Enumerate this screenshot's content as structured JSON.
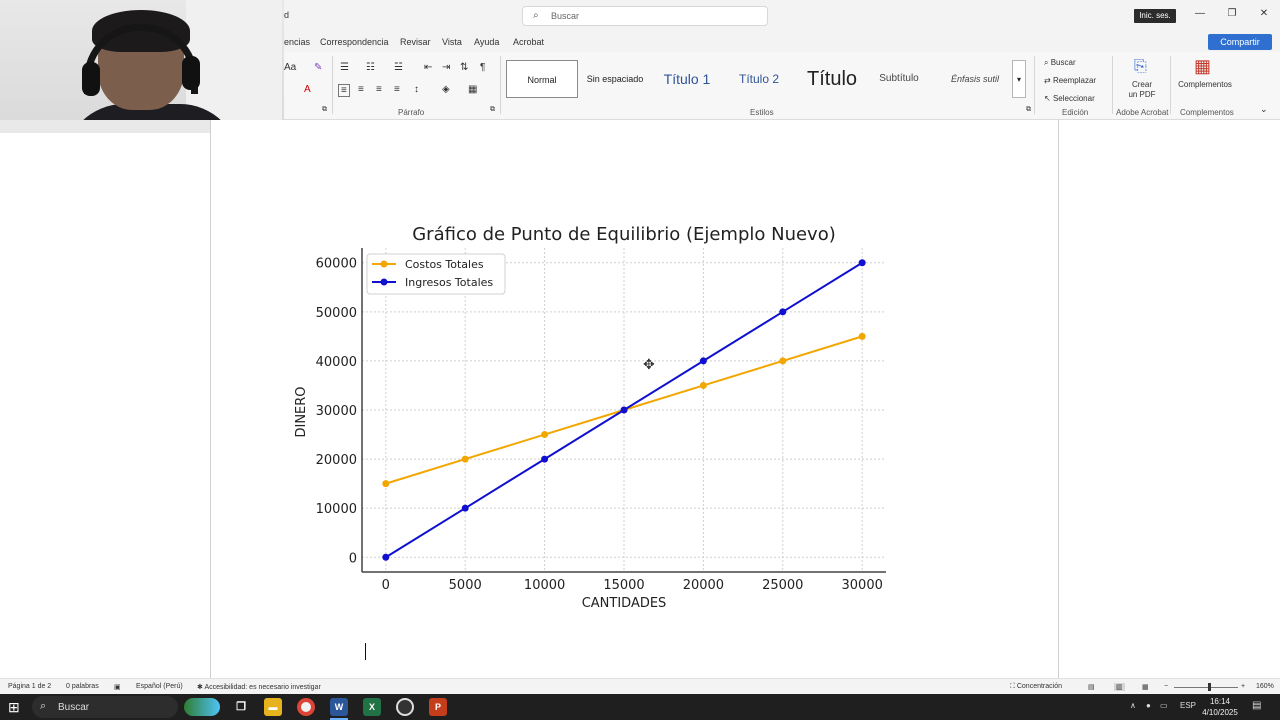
{
  "titlebar": {
    "doc_name": "d",
    "search_placeholder": "Buscar",
    "signin": "Inic. ses.",
    "minimize": "—",
    "restore": "❐",
    "close": "✕"
  },
  "ribbon_tabs": [
    "encias",
    "Correspondencia",
    "Revisar",
    "Vista",
    "Ayuda",
    "Acrobat"
  ],
  "share_label": "Compartir",
  "ribbon": {
    "paragraph_label": "Párrafo",
    "styles_label": "Estilos",
    "edit_label": "Edición",
    "acrobat_label": "Adobe Acrobat",
    "addins_label": "Complementos",
    "styles": [
      "Normal",
      "Sin espaciado",
      "Título 1",
      "Título 2",
      "Título",
      "Subtítulo",
      "Énfasis sutil"
    ],
    "edit_buttons": [
      "Buscar",
      "Reemplazar",
      "Seleccionar"
    ],
    "create_pdf": [
      "Crear",
      "un PDF"
    ],
    "addins": "Complementos",
    "font_label": "Aa"
  },
  "chart_data": {
    "type": "line",
    "title": "Gráfico de Punto de Equilibrio (Ejemplo Nuevo)",
    "xlabel": "CANTIDADES",
    "ylabel": "DINERO",
    "x": [
      0,
      5000,
      10000,
      15000,
      20000,
      25000,
      30000
    ],
    "x_ticks": [
      "0",
      "5000",
      "10000",
      "15000",
      "20000",
      "25000",
      "30000"
    ],
    "y_ticks": [
      "0",
      "10000",
      "20000",
      "30000",
      "40000",
      "50000",
      "60000"
    ],
    "xlim": [
      -1500,
      31500
    ],
    "ylim": [
      -3000,
      63000
    ],
    "grid": true,
    "legend_position": "top-left",
    "series": [
      {
        "name": "Costos Totales",
        "color": "#f2a600",
        "values": [
          15000,
          20000,
          25000,
          30000,
          35000,
          40000,
          45000
        ]
      },
      {
        "name": "Ingresos Totales",
        "color": "#1010d0",
        "values": [
          0,
          10000,
          20000,
          30000,
          40000,
          50000,
          60000
        ]
      }
    ]
  },
  "statusbar": {
    "page": "Página 1 de 2",
    "words": "0 palabras",
    "language": "Español (Perú)",
    "accessibility": "Accesibilidad: es necesario investigar",
    "focus": "Concentración",
    "zoom": "160%"
  },
  "taskbar": {
    "search": "Buscar",
    "lang": "ESP",
    "time": "16:14",
    "date": "4/10/2025"
  }
}
